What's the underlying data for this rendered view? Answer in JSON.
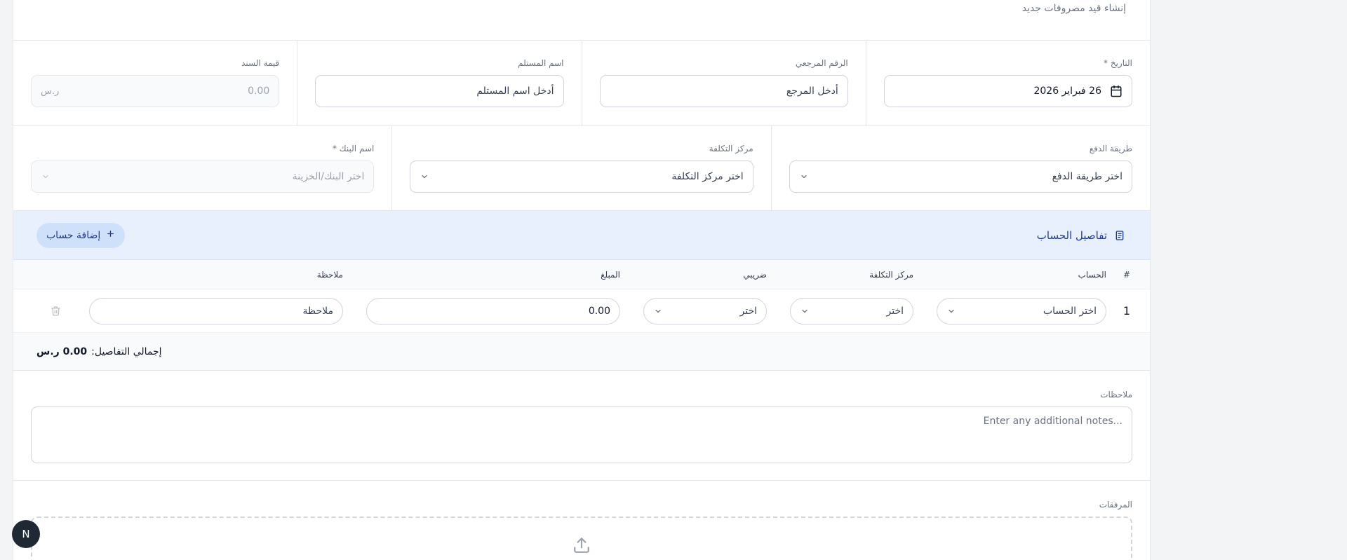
{
  "header": {
    "title": "إنشاء قيد مصروفات جديد"
  },
  "row1": {
    "date": {
      "label": "التاريخ *",
      "value": "26 فبراير 2026"
    },
    "reference": {
      "label": "الرقم المرجعي",
      "placeholder": "أدخل المرجع"
    },
    "recipient": {
      "label": "اسم المستلم",
      "placeholder": "أدخل اسم المستلم"
    },
    "voucher_amount": {
      "label": "قيمة السند",
      "value": "0.00",
      "currency": "ر.س"
    }
  },
  "row2": {
    "payment_method": {
      "label": "طريقة الدفع",
      "placeholder": "اختر طريقة الدفع"
    },
    "cost_center": {
      "label": "مركز التكلفة",
      "placeholder": "اختر مركز التكلفة"
    },
    "bank": {
      "label": "اسم البنك *",
      "placeholder": "اختر البنك/الخزينة"
    }
  },
  "accounts": {
    "title": "تفاصيل الحساب",
    "add_button": "إضافة حساب",
    "columns": {
      "index": "#",
      "account": "الحساب",
      "cost_center": "مركز التكلفة",
      "tax": "ضريبي",
      "amount": "المبلغ",
      "note": "ملاحظة"
    },
    "rows": [
      {
        "index": "1",
        "account": "اختر الحساب",
        "cost_center": "اختر",
        "tax": "اختر",
        "amount": "0.00",
        "note": "ملاحظة"
      }
    ],
    "total_label": "إجمالي التفاصيل:",
    "total_value": "0.00 ر.س"
  },
  "notes": {
    "label": "ملاحظات",
    "placeholder": "Enter any additional notes..."
  },
  "attachments": {
    "label": "المرفقات"
  },
  "fab": {
    "label": "N"
  },
  "colors": {
    "accent": "#1e3a8a",
    "accent_bg": "#e8f0fd",
    "button_bg": "#cfe0fb",
    "border": "#d1d5db"
  }
}
